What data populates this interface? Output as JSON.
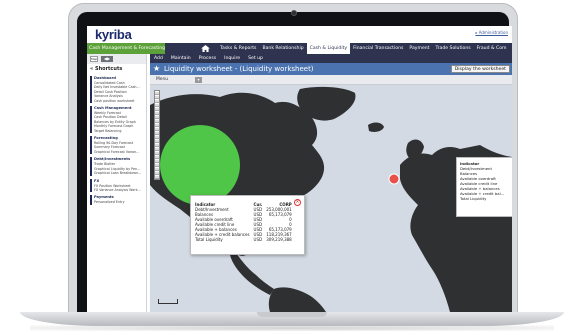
{
  "app": {
    "logo": "kyriba",
    "top_link": "▸ Administration",
    "module": "Cash Management & Forecasting",
    "nav": [
      "Tasks & Reports",
      "Bank Relationship",
      "Cash & Liquidity",
      "Financial Transactions",
      "Payment",
      "Trade Solutions",
      "Fraud & Com"
    ],
    "nav_active_index": 2
  },
  "sidebar": {
    "map_btn": "Map",
    "title": "Shortcuts",
    "groups": [
      {
        "title": "Dashboard",
        "items": [
          "Consolidated Cash",
          "Daily Net Investable Cash...",
          "Detail Cash Position",
          "Variance Analysis",
          "Cash position worksheet"
        ]
      },
      {
        "title": "Cash Management",
        "items": [
          "Weekly Forecast",
          "Cash Position Detail",
          "Balances by Entity Graph",
          "Monthly Forecast Graph",
          "Target Balancing"
        ]
      },
      {
        "title": "Forecasting",
        "items": [
          "Rolling 90-Day Forecast",
          "Summary Forecast",
          "Graphical Forecast Varian..."
        ]
      },
      {
        "title": "Debt/Investments",
        "items": [
          "Trade Blotter",
          "Graphical Liquidity by Pen...",
          "Graphical Loan Breakdown..."
        ]
      },
      {
        "title": "FX",
        "items": [
          "FX Position Worksheet",
          "FX Variance Analysis Work..."
        ]
      },
      {
        "title": "Payments",
        "items": [
          "Personalized Entry"
        ]
      }
    ]
  },
  "tabs": [
    "Add",
    "Maintain",
    "Process",
    "Inquire",
    "Set up"
  ],
  "page": {
    "title": "Liquidity worksheet - (Liquidity worksheet)",
    "display_button": "Display the worksheet",
    "menu_label": "Menu"
  },
  "popup": {
    "headers": [
      "Indicator",
      "Cur.",
      "CORP"
    ],
    "rows": [
      [
        "Debt/Investment",
        "USD",
        "253,000,001"
      ],
      [
        "Balances",
        "USD",
        "65,173,079"
      ],
      [
        "Available overdraft",
        "USD",
        "0"
      ],
      [
        "Available credit line",
        "USD",
        "0"
      ],
      [
        "Available + balances",
        "USD",
        "65,173,079"
      ],
      [
        "Available + credit balances",
        "USD",
        "118,219,367"
      ],
      [
        "Total Liquidity",
        "USD",
        "309,219,388"
      ]
    ]
  },
  "right_panel": {
    "items": [
      "Indicator",
      "Debt/Investment",
      "Balances",
      "Available overdraft",
      "Available credit line",
      "Available + balances",
      "Available + credit bal...",
      "Total Liquidity"
    ]
  },
  "colors": {
    "navy": "#2e3350",
    "module_green": "#5ca13a",
    "title_blue": "#4a73b0",
    "bubble_green": "#55e04c",
    "bubble_red": "#e8504a"
  }
}
